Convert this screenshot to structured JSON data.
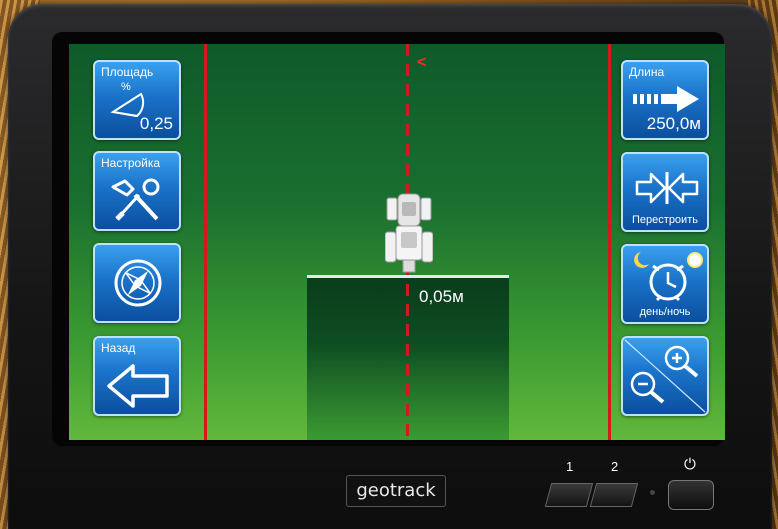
{
  "left_panel": {
    "area": {
      "label": "Площадь",
      "value": "0,25"
    },
    "settings": {
      "label": "Настройка"
    },
    "compass": {},
    "back": {
      "label": "Назад"
    }
  },
  "right_panel": {
    "length": {
      "label": "Длина",
      "value": "250,0м"
    },
    "rebuild": {
      "label": "Перестроить"
    },
    "daynight": {
      "label": "день/ночь"
    },
    "zoom": {}
  },
  "field": {
    "direction_marker": "<",
    "offset": "0,05м"
  },
  "device": {
    "brand": "geotrack",
    "hotkey1": "1",
    "hotkey2": "2",
    "power_symbol": "⏻"
  },
  "icons": {
    "area": "area-percent-icon",
    "settings": "tools-icon",
    "compass": "compass-icon",
    "back": "back-arrow-icon",
    "length": "forward-arrow-icon",
    "rebuild": "rebuild-arrows-icon",
    "daynight": "day-night-clock-icon",
    "zoom": "zoom-icon",
    "tractor": "tractor-icon"
  },
  "colors": {
    "guide_line": "#d21a1a",
    "button_blue": "#1a73c9",
    "field_green": "#1a6f2f"
  }
}
